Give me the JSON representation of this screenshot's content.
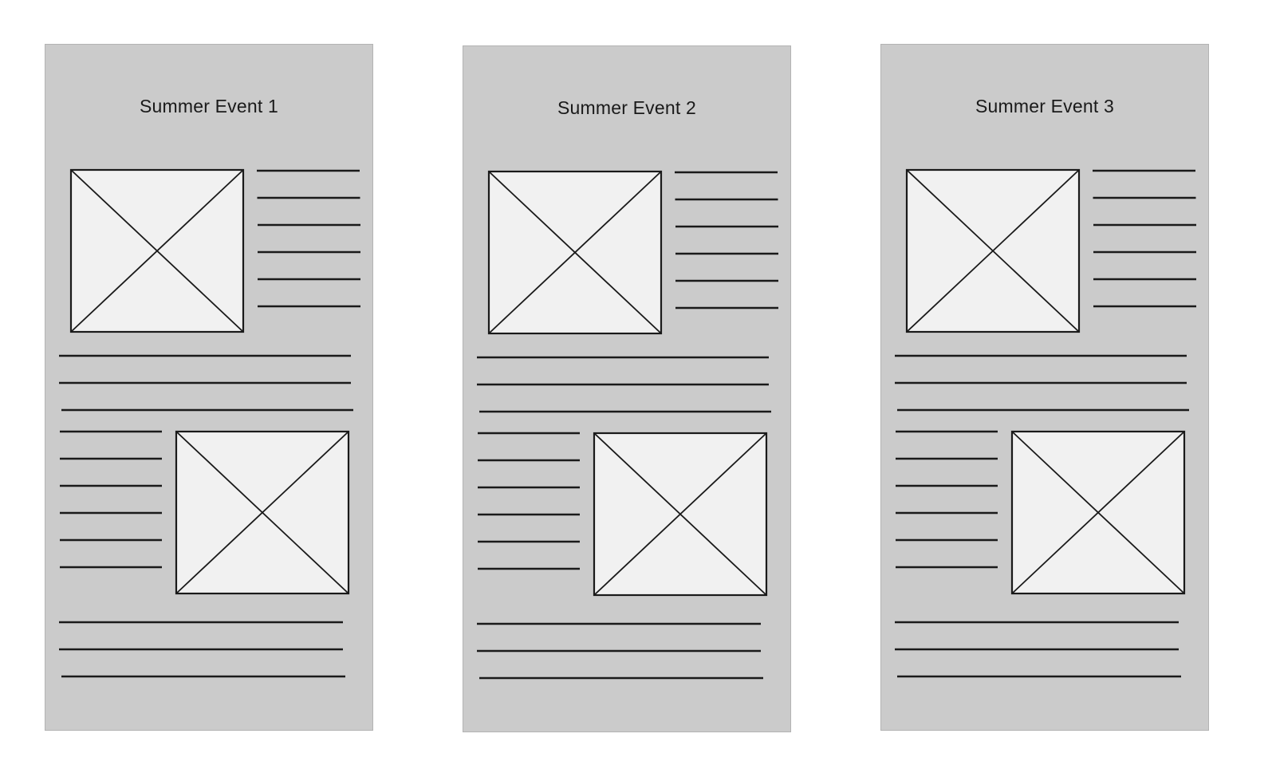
{
  "panels": [
    {
      "title": "Summer Event 1"
    },
    {
      "title": "Summer Event 2"
    },
    {
      "title": "Summer Event 3"
    }
  ],
  "colors": {
    "panel_background": "#cbcbcb",
    "image_placeholder_fill": "#f1f1f1",
    "line_color": "#1a1a1a"
  }
}
